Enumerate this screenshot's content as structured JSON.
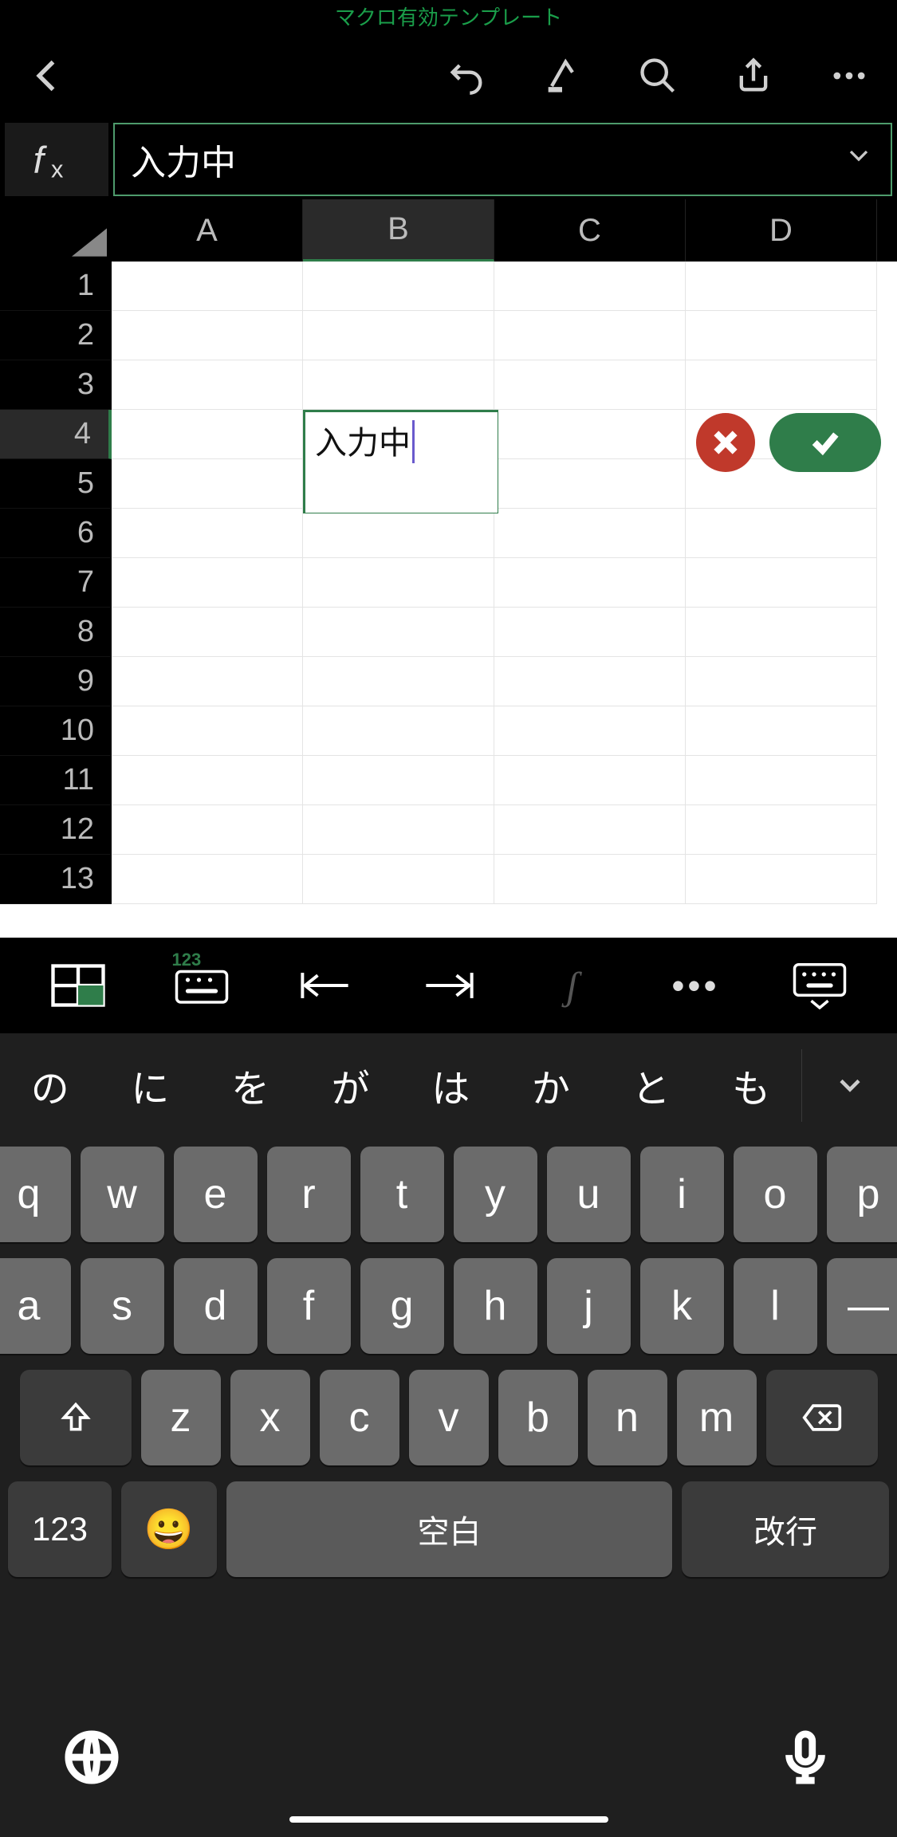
{
  "title": "マクロ有効テンプレート",
  "formula_bar": {
    "value": "入力中"
  },
  "columns": [
    "A",
    "B",
    "C",
    "D"
  ],
  "active_column_index": 1,
  "rows": [
    1,
    2,
    3,
    4,
    5,
    6,
    7,
    8,
    9,
    10,
    11,
    12,
    13
  ],
  "active_row_index": 3,
  "editing_cell": {
    "col": "B",
    "row": 4,
    "value": "入力中"
  },
  "midbar": {
    "num_badge": "123"
  },
  "keyboard": {
    "suggestions": [
      "の",
      "に",
      "を",
      "が",
      "は",
      "か",
      "と",
      "も"
    ],
    "row1": [
      "q",
      "w",
      "e",
      "r",
      "t",
      "y",
      "u",
      "i",
      "o",
      "p"
    ],
    "row2": [
      "a",
      "s",
      "d",
      "f",
      "g",
      "h",
      "j",
      "k",
      "l",
      "—"
    ],
    "row3": [
      "z",
      "x",
      "c",
      "v",
      "b",
      "n",
      "m"
    ],
    "mode_label": "123",
    "space_label": "空白",
    "enter_label": "改行"
  }
}
